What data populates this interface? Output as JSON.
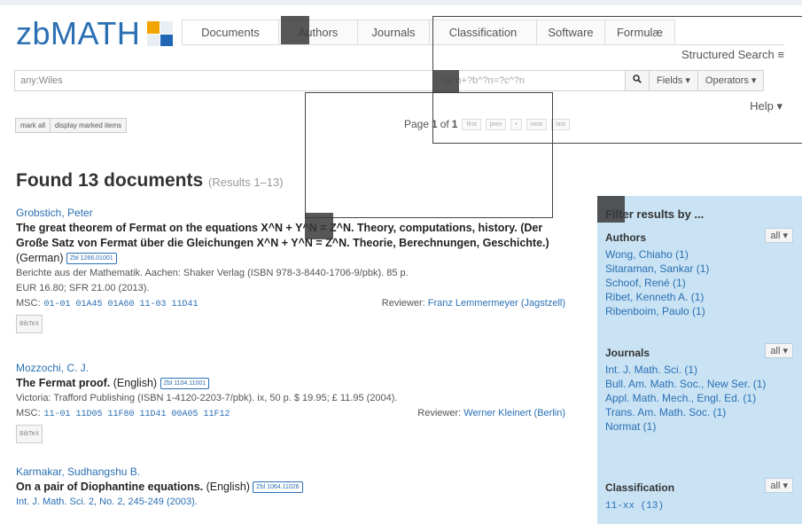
{
  "logo": {
    "text": "zbMATH"
  },
  "tabs": [
    "Documents",
    "Authors",
    "Journals",
    "Classification",
    "Software",
    "Formulæ"
  ],
  "structured_search": "Structured Search ≡",
  "search": {
    "value": "any:Wiles",
    "ghost": "?a^n+?b^?n=?c^?n"
  },
  "search_buttons": {
    "fields": "Fields ▾",
    "operators": "Operators ▾"
  },
  "help": "Help ▾",
  "actions": {
    "mark_all": "mark all",
    "display_marked": "display marked items"
  },
  "pager": {
    "prefix": "Page",
    "page": "1",
    "of": "of",
    "total": "1",
    "buttons": [
      "first",
      "prev",
      "•",
      "next",
      "last"
    ]
  },
  "found": {
    "title": "Found 13 documents",
    "sub": "(Results 1–13)"
  },
  "results": [
    {
      "author": "Grobstich, Peter",
      "title_1": "The great theorem of Fermat on the equations X^N + Y^N = Z^N. Theory, computations, history. (Der Große Satz von Fermat über die Gleichungen X^N + Y^N = Z^N. Theorie, Berechnungen, Geschichte.)",
      "lang": "(German)",
      "zbl": "Zbl 1266.01001",
      "source_1": "Berichte aus der Mathematik. Aachen: Shaker Verlag (ISBN 978-3-8440-1706-9/pbk). 85 p.",
      "source_2": "EUR 16.80; SFR 21.00 (2013).",
      "msc_label": "MSC:",
      "msc": "01-01 01A45 01A60 11-03 11D41",
      "rev_label": "Reviewer:",
      "reviewer": "Franz Lemmermeyer (Jagstzell)",
      "bibtex": "BibTeX"
    },
    {
      "author": "Mozzochi, C. J.",
      "title_1": "The Fermat proof.",
      "lang": "(English)",
      "zbl": "Zbl 1104.11001",
      "source_1": "Victoria: Trafford Publishing (ISBN 1-4120-2203-7/pbk). ix, 50 p. $ 19.95; £ 11.95 (2004).",
      "msc_label": "MSC:",
      "msc": "11-01 11D05 11F80 11D41 00A05 11F12",
      "rev_label": "Reviewer:",
      "reviewer": "Werner Kleinert (Berlin)",
      "bibtex": "BibTeX"
    },
    {
      "author": "Karmakar, Sudhangshu B.",
      "title_1": "On a pair of Diophantine equations.",
      "lang": "(English)",
      "zbl": "Zbl 1064.11026",
      "source_1": "Int. J. Math. Sci. 2, No. 2, 245-249 (2003)."
    }
  ],
  "facets": {
    "title": "Filter results by ...",
    "all_label": "all ▾",
    "authors": {
      "head": "Authors",
      "items": [
        "Wong, Chiaho (1)",
        "Sitaraman, Sankar (1)",
        "Schoof, René (1)",
        "Ribet, Kenneth A. (1)",
        "Ribenboim, Paulo (1)"
      ]
    },
    "journals": {
      "head": "Journals",
      "items": [
        "Int. J. Math. Sci. (1)",
        "Bull. Am. Math. Soc., New Ser. (1)",
        "Appl. Math. Mech., Engl. Ed. (1)",
        "Trans. Am. Math. Soc. (1)",
        "Normat (1)"
      ]
    },
    "classification": {
      "head": "Classification",
      "items": [
        "11-xx (13)"
      ]
    }
  },
  "icons": {
    "search": "search-icon"
  }
}
